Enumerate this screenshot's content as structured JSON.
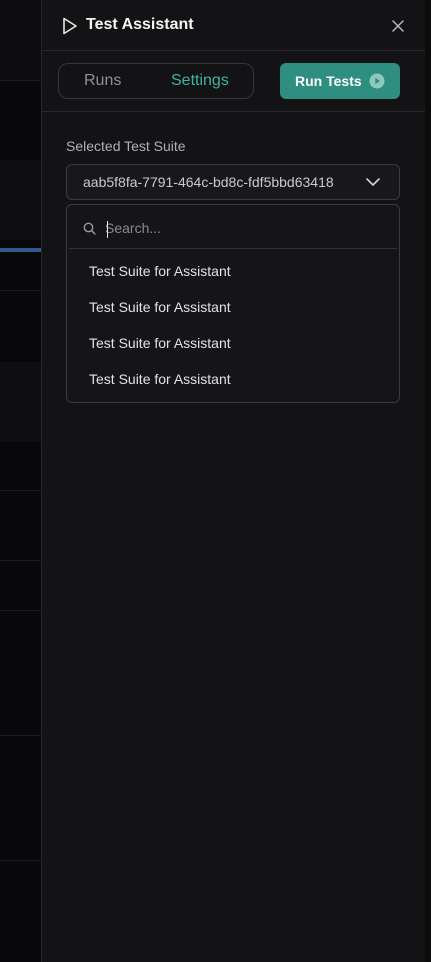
{
  "panel": {
    "title": "Test Assistant",
    "tabs": [
      {
        "label": "Runs",
        "active": false
      },
      {
        "label": "Settings",
        "active": true
      }
    ],
    "run_button_label": "Run Tests",
    "accent_color": "#2e8e80"
  },
  "settings": {
    "suite_label": "Selected Test Suite",
    "selected_suite": "aab5f8fa-7791-464c-bd8c-fdf5bbd63418",
    "search_placeholder": "Search...",
    "options": [
      "Test Suite for Assistant",
      "Test Suite for Assistant",
      "Test Suite for Assistant",
      "Test Suite for Assistant"
    ]
  }
}
